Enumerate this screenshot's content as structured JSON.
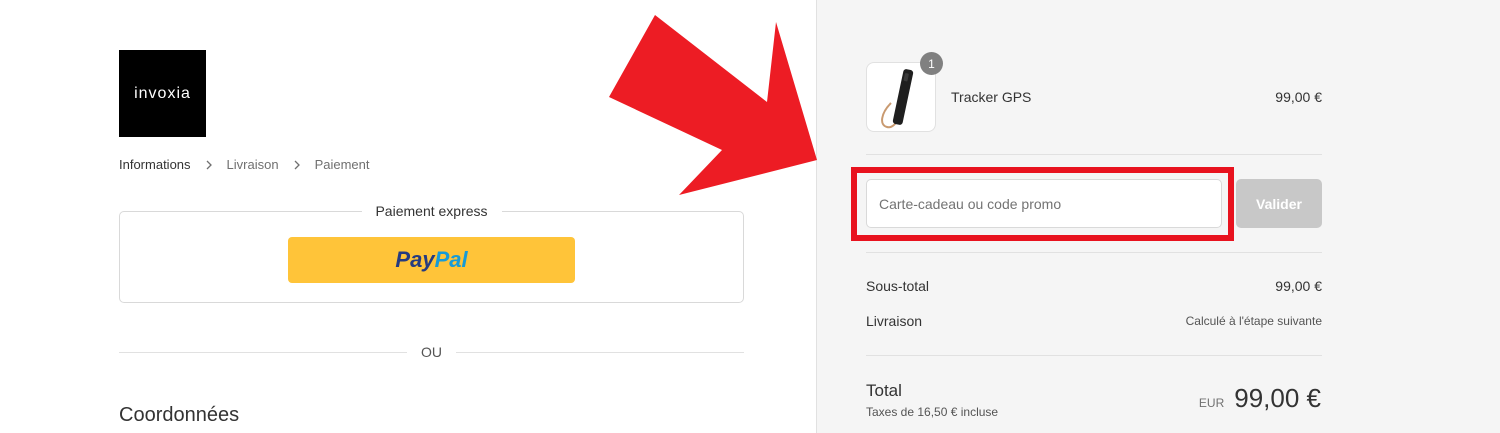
{
  "brand": {
    "logo_text": "invoxia"
  },
  "breadcrumb": {
    "items": [
      {
        "label": "Informations"
      },
      {
        "label": "Livraison"
      },
      {
        "label": "Paiement"
      }
    ]
  },
  "express": {
    "title": "Paiement express",
    "paypal": {
      "pay": "Pay",
      "pal": "Pal"
    }
  },
  "divider": {
    "text": "OU"
  },
  "contact": {
    "title": "Coordonnées"
  },
  "cart": {
    "item": {
      "name": "Tracker GPS",
      "price": "99,00 €",
      "quantity": "1",
      "icon": "gps-tracker-icon"
    }
  },
  "promo": {
    "placeholder": "Carte-cadeau ou code promo",
    "button": "Valider"
  },
  "summary": {
    "subtotal_label": "Sous-total",
    "subtotal_value": "99,00 €",
    "shipping_label": "Livraison",
    "shipping_value": "Calculé à l'étape suivante",
    "total_label": "Total",
    "tax_note": "Taxes de 16,50 € incluse",
    "currency": "EUR",
    "total_value": "99,00 €"
  },
  "colors": {
    "annotation_red": "#e8121e",
    "paypal_yellow": "#ffc439",
    "paypal_dark_blue": "#253b80",
    "paypal_light_blue": "#179bd7",
    "sidebar_bg": "#f5f5f5"
  }
}
